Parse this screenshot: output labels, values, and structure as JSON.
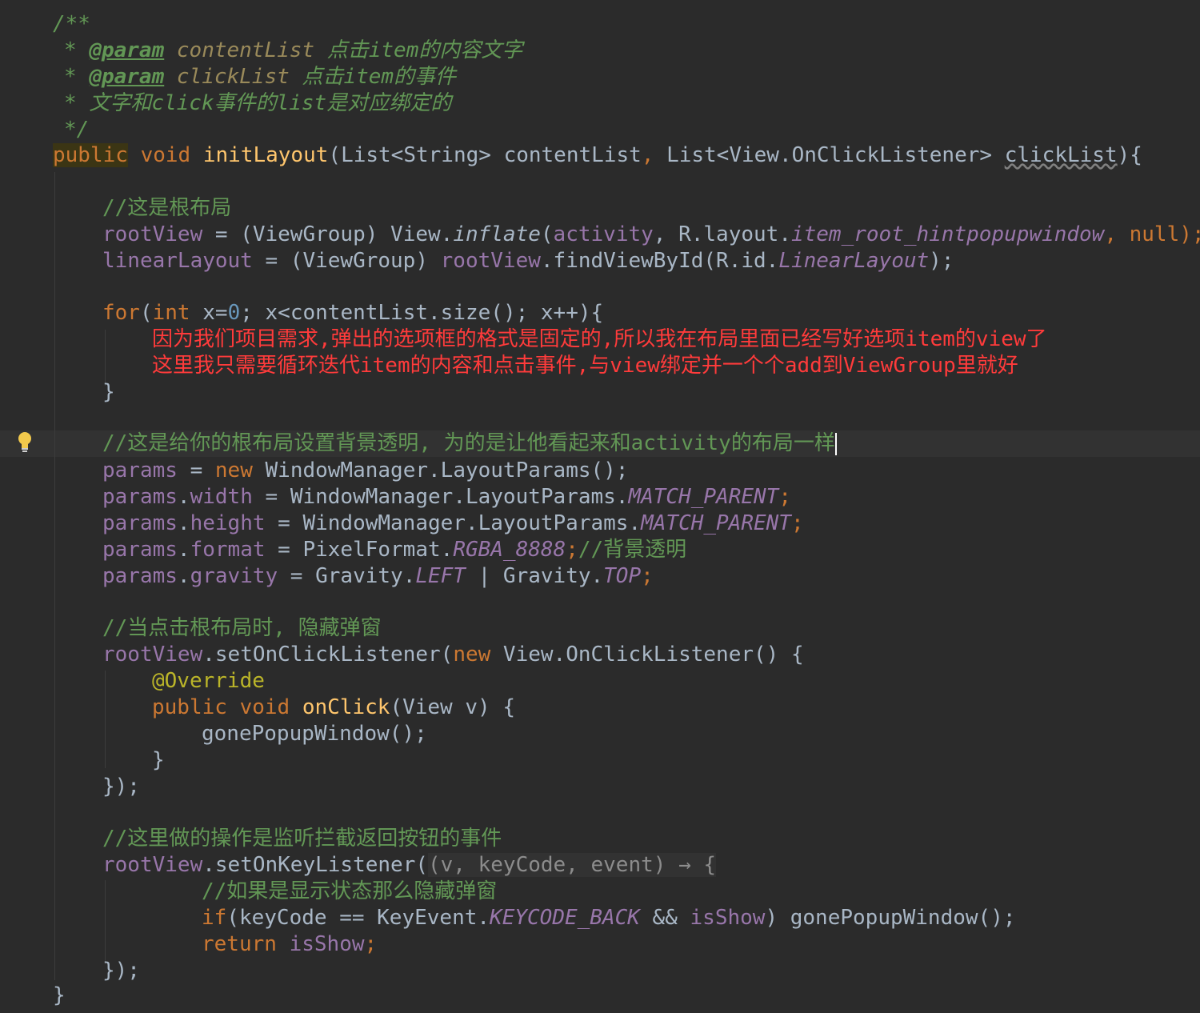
{
  "doc_comment": {
    "open": "/**",
    "star": "*",
    "param_tag": "@param",
    "p1_name": "contentList",
    "p1_desc": "点击item的内容文字",
    "p2_name": "clickList",
    "p2_desc": "点击item的事件",
    "note": "文字和click事件的list是对应绑定的",
    "close": "*/"
  },
  "signature": {
    "public": "public",
    "void": "void",
    "name": "initLayout",
    "open_paren": "(",
    "p1_type": "List<String>",
    "p1_name": "contentList",
    "comma": ",",
    "p2_type": "List<View.OnClickListener>",
    "p2_name": "clickList",
    "close": "){"
  },
  "block1": {
    "comment": "//这是根布局",
    "l1_var": "rootView",
    "l1_assign": " = (ViewGroup) View.",
    "l1_method": "inflate",
    "l1_open": "(",
    "l1_arg": "activity",
    "l1_mid": ", R.layout.",
    "l1_res": "item_root_hintpopupwindow",
    "l1_end": ", null);",
    "l2_var": "linearLayout",
    "l2_assign": " = (ViewGroup) ",
    "l2_var2": "rootView",
    "l2_mid": ".findViewById(R.id.",
    "l2_res": "LinearLayout",
    "l2_end": ");"
  },
  "loop": {
    "for": "for",
    "open": "(",
    "int": "int",
    "init": " x=",
    "zero": "0",
    "rest": "; x<contentList.size(); x++){",
    "note1": "因为我们项目需求,弹出的选项框的格式是固定的,所以我在布局里面已经写好选项item的view了",
    "note2": "这里我只需要循环迭代item的内容和点击事件,与view绑定并一个个add到ViewGroup里就好",
    "close": "}"
  },
  "params_block": {
    "comment": "//这是给你的根布局设置背景透明, 为的是让他看起来和activity的布局一样",
    "l1_var": "params",
    "l1_eq": " = ",
    "l1_new": "new",
    "l1_rest": " WindowManager.LayoutParams();",
    "l2_var": "params",
    "l2_dot": ".",
    "l2_field": "width",
    "l2_mid": " = WindowManager.LayoutParams.",
    "l2_const": "MATCH_PARENT",
    "l2_end": ";",
    "l3_var": "params",
    "l3_dot": ".",
    "l3_field": "height",
    "l3_mid": " = WindowManager.LayoutParams.",
    "l3_const": "MATCH_PARENT",
    "l3_end": ";",
    "l4_var": "params",
    "l4_dot": ".",
    "l4_field": "format",
    "l4_mid": " = PixelFormat.",
    "l4_const": "RGBA_8888",
    "l4_end": ";",
    "l4_comment": "//背景透明",
    "l5_var": "params",
    "l5_dot": ".",
    "l5_field": "gravity",
    "l5_mid": " = Gravity.",
    "l5_const1": "LEFT",
    "l5_pipe": " | Gravity.",
    "l5_const2": "TOP",
    "l5_end": ";"
  },
  "click_block": {
    "comment": "//当点击根布局时, 隐藏弹窗",
    "l1_var": "rootView",
    "l1_mid": ".setOnClickListener(",
    "l1_new": "new",
    "l1_rest": " View.OnClickListener() {",
    "override": "@Override",
    "public": "public",
    "void": "void",
    "method": "onClick",
    "params": "(View v) {",
    "call": "gonePopupWindow();",
    "close_inner": "}",
    "close_outer": "});"
  },
  "key_block": {
    "comment": "//这里做的操作是监听拦截返回按钮的事件",
    "l1_var": "rootView",
    "l1_mid": ".setOnKeyListener(",
    "lambda": "(v, keyCode, event) → {",
    "inner_comment": "//如果是显示状态那么隐藏弹窗",
    "if": "if",
    "if_mid": "(keyCode == KeyEvent.",
    "if_const": "KEYCODE_BACK",
    "if_and": " && ",
    "if_field": "isShow",
    "if_end": ") gonePopupWindow();",
    "return": "return",
    "ret_field": "isShow",
    "ret_end": ";",
    "close": "});"
  },
  "method_close": "}"
}
